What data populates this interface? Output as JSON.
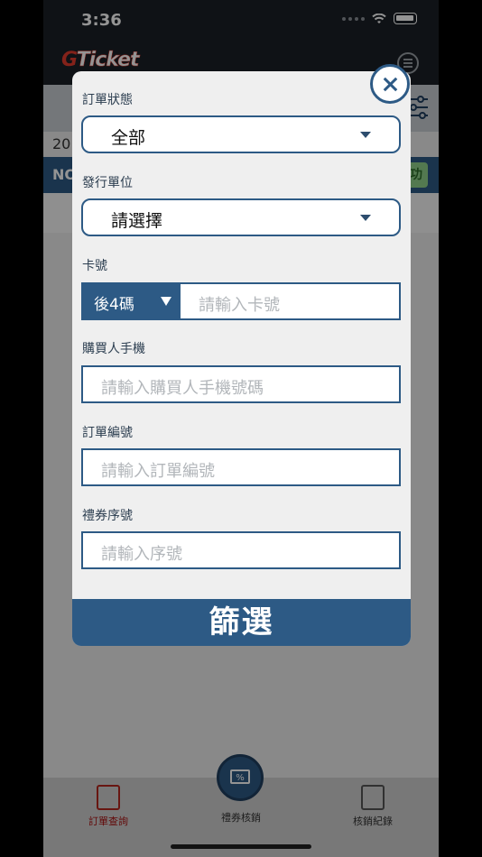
{
  "status_bar": {
    "time": "3:36"
  },
  "header": {
    "logo": "Ticket"
  },
  "background": {
    "date_prefix": "20",
    "header_prefix": "NO",
    "status_badge": "功"
  },
  "modal": {
    "order_status": {
      "label": "訂單狀態",
      "value": "全部"
    },
    "issuer": {
      "label": "發行單位",
      "value": "請選擇"
    },
    "card": {
      "label": "卡號",
      "mode": "後4碼",
      "placeholder": "請輸入卡號"
    },
    "buyer_phone": {
      "label": "購買人手機",
      "placeholder": "請輸入購買人手機號碼"
    },
    "order_no": {
      "label": "訂單編號",
      "placeholder": "請輸入訂單編號"
    },
    "voucher_no": {
      "label": "禮券序號",
      "placeholder": "請輸入序號"
    },
    "submit_label": "篩選"
  },
  "tabs": [
    {
      "label": "訂單查詢",
      "icon": "order-search-icon",
      "active": true
    },
    {
      "label": "禮券核銷",
      "icon": "voucher-scan-icon",
      "active": false
    },
    {
      "label": "核銷紀錄",
      "icon": "record-icon",
      "active": false
    }
  ],
  "colors": {
    "primary": "#2d5a85",
    "active_tab": "#b3261e"
  }
}
